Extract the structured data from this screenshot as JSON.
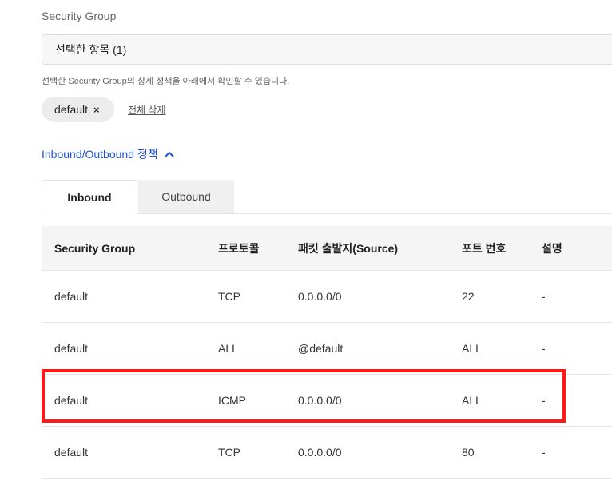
{
  "security_group": {
    "label": "Security Group",
    "select_value": "선택한 항목 (1)",
    "helper_text": "선택한 Security Group의 상세 정책을 아래에서 확인할 수 있습니다.",
    "chip_label": "default",
    "chip_remove": "×",
    "clear_all": "전체 삭제"
  },
  "policy": {
    "toggle_label": "Inbound/Outbound 정책",
    "accent_color": "#1f50d6"
  },
  "tabs": [
    {
      "label": "Inbound",
      "active": true
    },
    {
      "label": "Outbound",
      "active": false
    }
  ],
  "table": {
    "columns": [
      "Security Group",
      "프로토콜",
      "패킷 출발지(Source)",
      "포트 번호",
      "설명"
    ],
    "rows": [
      [
        "default",
        "TCP",
        "0.0.0.0/0",
        "22",
        "-"
      ],
      [
        "default",
        "ALL",
        "@default",
        "ALL",
        "-"
      ],
      [
        "default",
        "ICMP",
        "0.0.0.0/0",
        "ALL",
        "-"
      ],
      [
        "default",
        "TCP",
        "0.0.0.0/0",
        "80",
        "-"
      ]
    ],
    "highlighted_row": 2,
    "highlight_color": "#ff1a1a"
  }
}
